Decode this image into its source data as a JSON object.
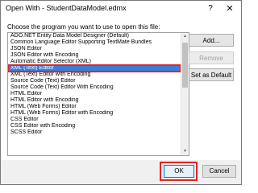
{
  "dialog": {
    "title": "Open With - StudentDataModel.edmx",
    "help_label": "?",
    "close_label": "✕",
    "prompt": "Choose the program you want to use to open this file:"
  },
  "programs": {
    "items": [
      "ADO.NET Entity Data Model Designer (Default)",
      "Common Language Editor Supporting TextMate Bundles",
      "JSON Editor",
      "JSON Editor with Encoding",
      "Automatic Editor Selector (XML)",
      "XML (Text) Editor",
      "XML (Text) Editor with Encoding",
      "Source Code (Text) Editor",
      "Source Code (Text) Editor With Encoding",
      "HTML Editor",
      "HTML Editor with Encoding",
      "HTML (Web Forms) Editor",
      "HTML (Web Forms) Editor with Encoding",
      "CSS Editor",
      "CSS Editor with Encoding",
      "SCSS Editor"
    ],
    "selected_index": 5
  },
  "buttons": {
    "add": "Add...",
    "remove": "Remove",
    "set_default": "Set as Default",
    "ok": "OK",
    "cancel": "Cancel"
  },
  "scrollbar": {
    "up_icon": "▲",
    "down_icon": "▼"
  },
  "colors": {
    "selection": "#3a7fd6",
    "highlight_outline": "#e02424",
    "ok_border": "#0078d7"
  }
}
